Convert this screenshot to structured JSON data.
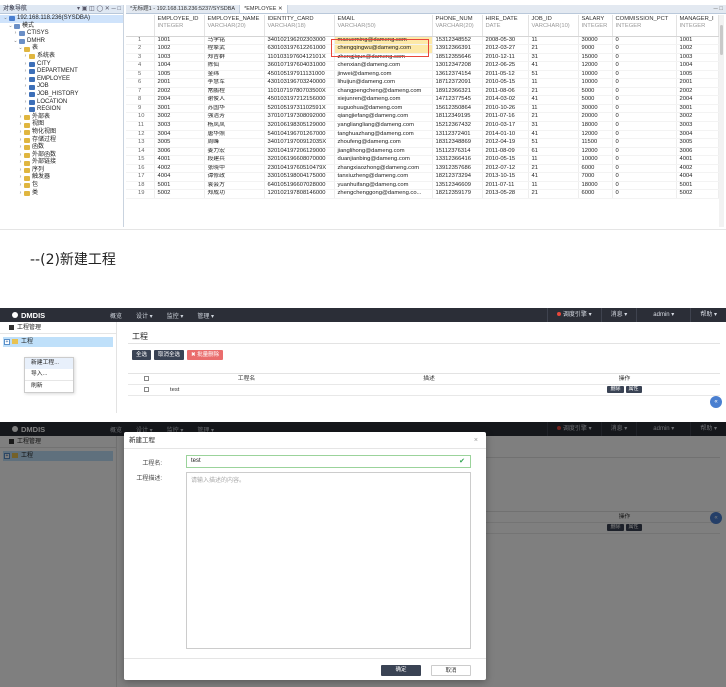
{
  "db": {
    "nav_title": "对象导航",
    "nav_toolbar": "▾ ▣ ◫ ◯ ✕ ─ □",
    "tree": [
      {
        "label": "192.168.118.236(SYSDBA)",
        "level": 0,
        "twist": "⌄",
        "icon": "db",
        "selected": true
      },
      {
        "label": "模式",
        "level": 1,
        "twist": "⌄",
        "icon": "sc"
      },
      {
        "label": "CTISYS",
        "level": 2,
        "twist": "›",
        "icon": "sc"
      },
      {
        "label": "DMHR",
        "level": 2,
        "twist": "⌄",
        "icon": "sc"
      },
      {
        "label": "表",
        "level": 3,
        "twist": "⌄",
        "icon": "fo"
      },
      {
        "label": "系统表",
        "level": 4,
        "twist": "›",
        "icon": "fo"
      },
      {
        "label": "CITY",
        "level": 4,
        "twist": "›",
        "icon": "tb"
      },
      {
        "label": "DEPARTMENT",
        "level": 4,
        "twist": "›",
        "icon": "tb"
      },
      {
        "label": "EMPLOYEE",
        "level": 4,
        "twist": "›",
        "icon": "tb"
      },
      {
        "label": "JOB",
        "level": 4,
        "twist": "›",
        "icon": "tb"
      },
      {
        "label": "JOB_HISTORY",
        "level": 4,
        "twist": "›",
        "icon": "tb"
      },
      {
        "label": "LOCATION",
        "level": 4,
        "twist": "›",
        "icon": "tb"
      },
      {
        "label": "REGION",
        "level": 4,
        "twist": "›",
        "icon": "tb"
      },
      {
        "label": "外部表",
        "level": 3,
        "twist": "›",
        "icon": "fo"
      },
      {
        "label": "视图",
        "level": 3,
        "twist": "›",
        "icon": "fo"
      },
      {
        "label": "物化视图",
        "level": 3,
        "twist": "›",
        "icon": "fo"
      },
      {
        "label": "存储过程",
        "level": 3,
        "twist": "›",
        "icon": "fo"
      },
      {
        "label": "函数",
        "level": 3,
        "twist": "›",
        "icon": "fo"
      },
      {
        "label": "外部函数",
        "level": 3,
        "twist": "›",
        "icon": "fo"
      },
      {
        "label": "外部链接",
        "level": 3,
        "twist": "›",
        "icon": "fo"
      },
      {
        "label": "序列",
        "level": 3,
        "twist": "›",
        "icon": "fo"
      },
      {
        "label": "触发器",
        "level": 3,
        "twist": "›",
        "icon": "fo"
      },
      {
        "label": "包",
        "level": 3,
        "twist": "›",
        "icon": "fo"
      },
      {
        "label": "类",
        "level": 3,
        "twist": "›",
        "icon": "fo"
      }
    ],
    "tabs": [
      "*无标题1 - 192.168.118.236:5237/SYSDBA",
      "*EMPLOYEE ✕"
    ],
    "win_controls": "─ □",
    "columns": [
      {
        "name": "",
        "type": ""
      },
      {
        "name": "EMPLOYEE_ID",
        "type": "INTEGER"
      },
      {
        "name": "EMPLOYEE_NAME",
        "type": "VARCHAR(20)"
      },
      {
        "name": "IDENTITY_CARD",
        "type": "VARCHAR(18)"
      },
      {
        "name": "EMAIL",
        "type": "VARCHAR(50)"
      },
      {
        "name": "PHONE_NUM",
        "type": "VARCHAR(20)"
      },
      {
        "name": "HIRE_DATE",
        "type": "DATE"
      },
      {
        "name": "JOB_ID",
        "type": "VARCHAR(10)"
      },
      {
        "name": "SALARY",
        "type": "INTEGER"
      },
      {
        "name": "COMMISSION_PCT",
        "type": "INTEGER"
      },
      {
        "name": "MANAGER_I",
        "type": "INTEGER"
      }
    ],
    "rows": [
      [
        "1",
        "1001",
        "马学铭",
        "340102196202303000",
        "maxueming@dameng.com",
        "15312348552",
        "2008-05-30",
        "11",
        "30000",
        "0",
        "1001"
      ],
      [
        "2",
        "1002",
        "程擎武",
        "630103197612261000",
        "chengqingwu@dameng.com",
        "13912366391",
        "2012-03-27",
        "21",
        "9000",
        "0",
        "1002"
      ],
      [
        "3",
        "1003",
        "郑吉群",
        "11010319760412101X",
        "zhengjiqun@dameng.com",
        "18512355646",
        "2010-12-11",
        "31",
        "15000",
        "0",
        "1003"
      ],
      [
        "4",
        "1004",
        "陈仙",
        "360107197604031000",
        "chenxian@dameng.com",
        "13012347208",
        "2012-06-25",
        "41",
        "12000",
        "0",
        "1004"
      ],
      [
        "5",
        "1005",
        "金纬",
        "450105197911131000",
        "jinwei@dameng.com",
        "13612374154",
        "2011-05-12",
        "51",
        "10000",
        "0",
        "1005"
      ],
      [
        "6",
        "2001",
        "李慧军",
        "430103196703240000",
        "lihuijun@dameng.com",
        "18712372091",
        "2010-05-15",
        "11",
        "10000",
        "0",
        "2001"
      ],
      [
        "7",
        "2002",
        "常鹏程",
        "11010719780703500X",
        "changpengcheng@dameng.com",
        "18912366321",
        "2011-08-06",
        "21",
        "5000",
        "0",
        "2002"
      ],
      [
        "8",
        "2004",
        "谢俊人",
        "450103197212156000",
        "xiejunren@dameng.com",
        "14712377545",
        "2014-03-02",
        "41",
        "5000",
        "0",
        "2004"
      ],
      [
        "9",
        "3001",
        "苏国华",
        "52010519731102591X",
        "suguohua@dameng.com",
        "15612350864",
        "2010-10-26",
        "11",
        "30000",
        "0",
        "3001"
      ],
      [
        "10",
        "3002",
        "强洁芳",
        "370107197308092000",
        "qiangjiefang@dameng.com",
        "18112349195",
        "2011-07-16",
        "21",
        "20000",
        "0",
        "3002"
      ],
      [
        "11",
        "3003",
        "杨凤凤",
        "320106198305129000",
        "yangliangliang@dameng.com",
        "15212367432",
        "2010-03-17",
        "31",
        "18000",
        "0",
        "3003"
      ],
      [
        "12",
        "3004",
        "唐华照",
        "540104196701267000",
        "tanghuazhang@dameng.com",
        "13112372401",
        "2014-01-10",
        "41",
        "12000",
        "0",
        "3004"
      ],
      [
        "13",
        "3005",
        "周峰",
        "34010719700912035X",
        "zhoufeng@dameng.com",
        "18312348869",
        "2012-04-19",
        "51",
        "11500",
        "0",
        "3005"
      ],
      [
        "14",
        "3006",
        "姜力宏",
        "320104197206129000",
        "jianglihong@dameng.com",
        "15112376314",
        "2011-08-09",
        "61",
        "12000",
        "0",
        "3006"
      ],
      [
        "15",
        "4001",
        "段建兵",
        "320106196608070000",
        "duanjianbing@dameng.com",
        "13312366416",
        "2010-05-15",
        "11",
        "10000",
        "0",
        "4001"
      ],
      [
        "16",
        "4002",
        "张晓中",
        "23010419760510479X",
        "zhangxiaozhong@dameng.com",
        "13912357686",
        "2012-07-12",
        "21",
        "6000",
        "0",
        "4002"
      ],
      [
        "17",
        "4004",
        "谭修政",
        "330105198004175000",
        "tanxiuzheng@dameng.com",
        "18212373294",
        "2013-10-15",
        "41",
        "7000",
        "0",
        "4004"
      ],
      [
        "18",
        "5001",
        "袁会方",
        "640105196607028000",
        "yuanhuifang@dameng.com",
        "13512346609",
        "2011-07-11",
        "11",
        "18000",
        "0",
        "5001"
      ],
      [
        "19",
        "5002",
        "郑成功",
        "120102197808146000",
        "zhengchenggong@dameng.co...",
        "18212359179",
        "2013-05-28",
        "21",
        "6000",
        "0",
        "5002"
      ]
    ]
  },
  "heading": "--(2)新建工程",
  "app": {
    "brand": "DMDIS",
    "menu": [
      "概览",
      "设计 ▾",
      "监控 ▾",
      "管理 ▾"
    ],
    "right_menu": [
      "调度引擎 ▾",
      "消息 ▾",
      "admin ▾",
      "帮助 ▾"
    ],
    "sidebar_title": "工程管理",
    "tree_root": "工程",
    "context_menu": [
      "新建工程...",
      "导入...",
      "刷新"
    ],
    "page_title": "工程",
    "buttons": {
      "select_all": "全选",
      "deselect_all": "取消全选",
      "batch_delete": "✖ 批量删除"
    },
    "table_headers": [
      "",
      "工程名",
      "描述",
      "操作"
    ],
    "table_rows": [
      {
        "name": "test",
        "desc": "",
        "actions": [
          "删除",
          "属性"
        ]
      }
    ],
    "side_tab": "«"
  },
  "modal": {
    "title": "新建工程",
    "close": "×",
    "name_label": "工程名:",
    "name_value": "test",
    "desc_label": "工程描述:",
    "desc_placeholder": "请输入描述的内容。",
    "ok": "确定",
    "cancel": "取消"
  }
}
